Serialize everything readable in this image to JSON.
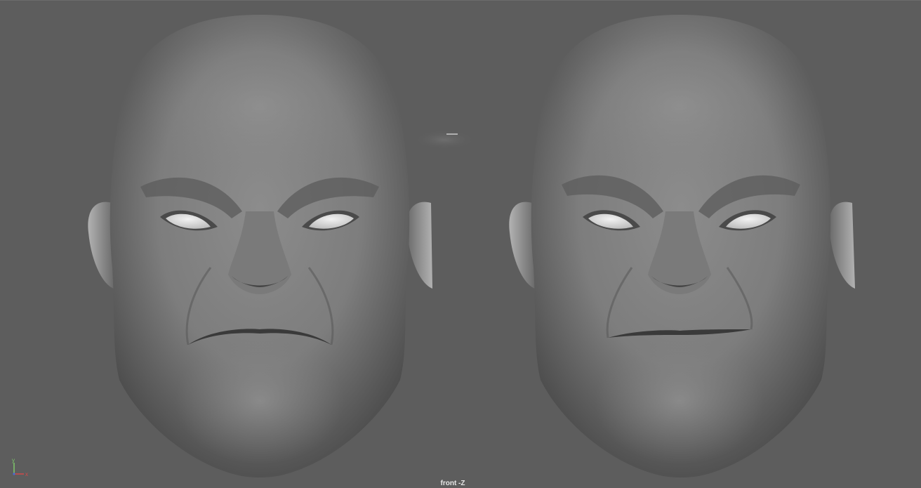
{
  "viewport": {
    "camera_label": "front -Z",
    "background_color": "#5d5d5d"
  },
  "axis_gizmo": {
    "y_label": "y",
    "x_label": "x",
    "y_color": "#7ec86b",
    "x_color": "#d24a4a",
    "z_color": "#4a6ad2"
  },
  "models": [
    {
      "name": "head-model-left"
    },
    {
      "name": "head-model-right"
    }
  ]
}
